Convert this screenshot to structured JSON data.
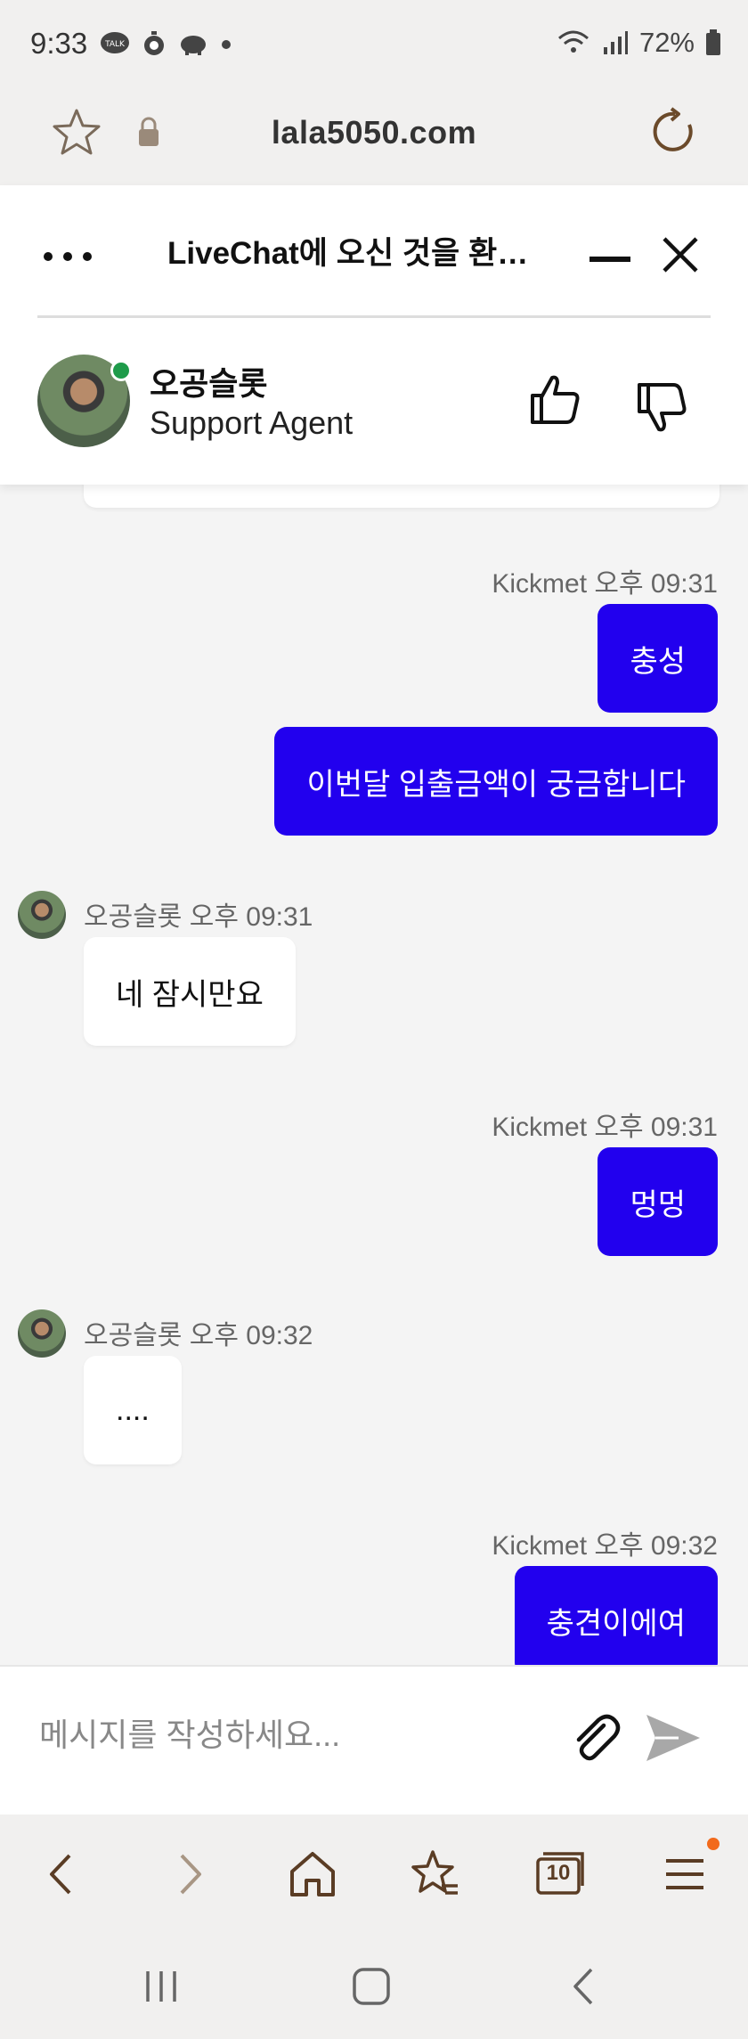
{
  "status_bar": {
    "time": "9:33",
    "battery": "72%",
    "left_icons": [
      "talk-icon",
      "stopwatch-icon",
      "piggy-icon",
      "dot-icon"
    ],
    "right_icons": [
      "wifi-icon",
      "signal-icon",
      "battery-icon"
    ]
  },
  "browser": {
    "url": "lala5050.com"
  },
  "chat_header": {
    "title": "LiveChat에 오신 것을 환영합니다",
    "agent_name": "오공슬롯",
    "agent_role": "Support Agent",
    "online_color": "#1e9b4a"
  },
  "messages": [
    {
      "sender": "Kickmet",
      "time": "오후 09:31",
      "meta": "Kickmet 오후 09:31",
      "direction": "out",
      "text": "충성"
    },
    {
      "sender": "Kickmet",
      "direction": "out",
      "text": "이번달 입출금액이 궁금합니다"
    },
    {
      "sender": "오공슬롯",
      "time": "오후 09:31",
      "meta": "오공슬롯 오후 09:31",
      "direction": "in",
      "text": "네 잠시만요"
    },
    {
      "sender": "Kickmet",
      "time": "오후 09:31",
      "meta": "Kickmet 오후 09:31",
      "direction": "out",
      "text": "멍멍"
    },
    {
      "sender": "오공슬롯",
      "time": "오후 09:32",
      "meta": "오공슬롯 오후 09:32",
      "direction": "in",
      "text": "...."
    },
    {
      "sender": "Kickmet",
      "time": "오후 09:32",
      "meta": "Kickmet 오후 09:32",
      "direction": "out",
      "text": "충견이에여"
    }
  ],
  "composer": {
    "placeholder": "메시지를 작성하세요..."
  },
  "colors": {
    "outgoing_bubble": "#2200ee",
    "incoming_bubble": "#ffffff",
    "notification_dot": "#f26a1b"
  },
  "bottom_nav": [
    "back-icon",
    "forward-icon",
    "home-icon",
    "bookmarks-icon",
    "tabs-icon",
    "menu-icon"
  ],
  "tab_count": "10"
}
